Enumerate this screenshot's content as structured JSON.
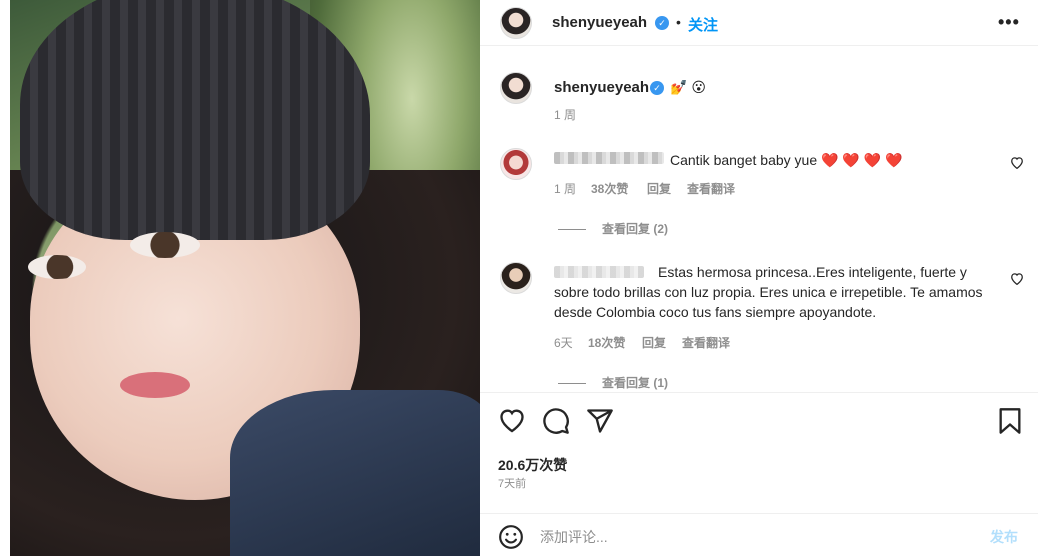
{
  "post": {
    "username": "shenyueyeah",
    "follow_label": "关注",
    "separator": "•",
    "more_label": "•••",
    "verified_mark": "✓",
    "caption_emojis": "💅 😮",
    "caption_time": "1 周",
    "likes": "20.6万次赞",
    "time_ago": "7天前",
    "add_comment_placeholder": "添加评论...",
    "post_button": "发布"
  },
  "comments": [
    {
      "text": "Cantik banget baby yue ❤️ ❤️ ❤️ ❤️",
      "time": "1 周",
      "likes": "38次赞",
      "reply_label": "回复",
      "translate_label": "查看翻译",
      "view_replies": "查看回复 (2)"
    },
    {
      "text": "Estas hermosa princesa..Eres inteligente, fuerte y sobre todo brillas con luz propia. Eres unica e irrepetible. Te amamos desde Colombia coco tus fans siempre apoyandote.",
      "time": "6天",
      "likes": "18次赞",
      "reply_label": "回复",
      "translate_label": "查看翻译",
      "view_replies": "查看回复 (1)"
    }
  ],
  "icons": {
    "like": "heart-icon",
    "comment": "comment-icon",
    "share": "paper-plane-icon",
    "save": "bookmark-icon",
    "emoji": "smiley-icon",
    "comment_like": "small-heart-icon"
  },
  "colors": {
    "link_blue": "#0095f6",
    "verified_blue": "#3897f0",
    "muted": "#8e8e8e",
    "text": "#262626",
    "post_disabled": "#b2dffc"
  }
}
